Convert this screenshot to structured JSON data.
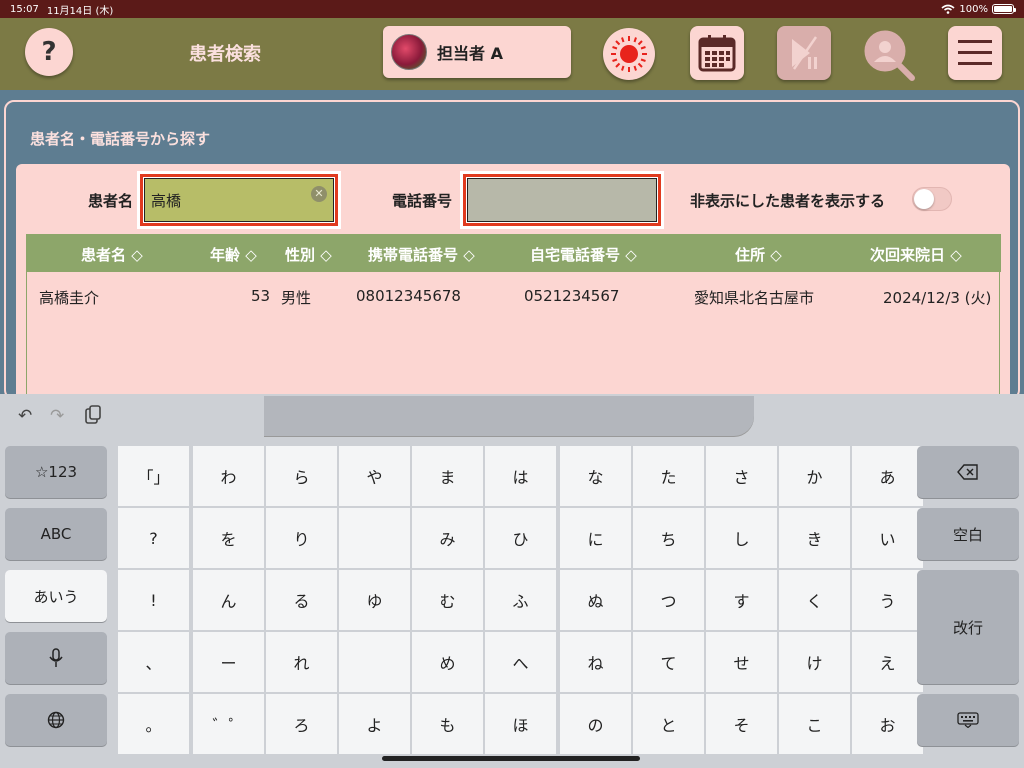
{
  "status_bar": {
    "time": "15:07",
    "date": "11月14日 (木)",
    "wifi": "wifi-icon",
    "battery": "100%"
  },
  "header": {
    "help_label": "?",
    "title": "患者検索",
    "user_name": "担当者 A",
    "icons": [
      "help-icon",
      "sun-icon",
      "calendar-icon",
      "play-pause-icon",
      "person-search-icon",
      "hamburger-menu-icon"
    ],
    "accent_color": "#7c7a45",
    "button_color": "#fcd6d2"
  },
  "search": {
    "section_title": "患者名・電話番号から探す",
    "name_label": "患者名",
    "name_value": "高橋",
    "phone_label": "電話番号",
    "phone_value": "",
    "show_hidden_label": "非表示にした患者を表示する",
    "show_hidden_on": false
  },
  "table": {
    "columns": [
      "患者名 ◇",
      "年齢 ◇",
      "性別 ◇",
      "携帯電話番号 ◇",
      "自宅電話番号 ◇",
      "住所 ◇",
      "次回来院日 ◇"
    ],
    "rows": [
      {
        "name": "高橋圭介",
        "age": "53",
        "sex": "男性",
        "mobile": "08012345678",
        "home": "0521234567",
        "address": "愛知県北名古屋市",
        "next_visit": "2024/12/3 (火)"
      }
    ]
  },
  "keyboard": {
    "toolbar": [
      "undo-icon",
      "redo-icon",
      "paste-icon"
    ],
    "left_keys": [
      "☆123",
      "ABC",
      "あいう",
      "🎤",
      "🌐"
    ],
    "right_keys": [
      "⌫",
      "空白",
      "改行",
      "⌨"
    ],
    "grid": [
      [
        "「」",
        "わ",
        "ら",
        "や",
        "ま",
        "は",
        "な",
        "た",
        "さ",
        "か",
        "あ"
      ],
      [
        "?",
        "を",
        "り",
        "",
        "み",
        "ひ",
        "に",
        "ち",
        "し",
        "き",
        "い"
      ],
      [
        "!",
        "ん",
        "る",
        "ゆ",
        "む",
        "ふ",
        "ぬ",
        "つ",
        "す",
        "く",
        "う"
      ],
      [
        "、",
        "ー",
        "れ",
        "",
        "め",
        "へ",
        "ね",
        "て",
        "せ",
        "け",
        "え"
      ],
      [
        "。",
        "゛゜",
        "ろ",
        "よ",
        "も",
        "ほ",
        "の",
        "と",
        "そ",
        "こ",
        "お"
      ]
    ]
  }
}
